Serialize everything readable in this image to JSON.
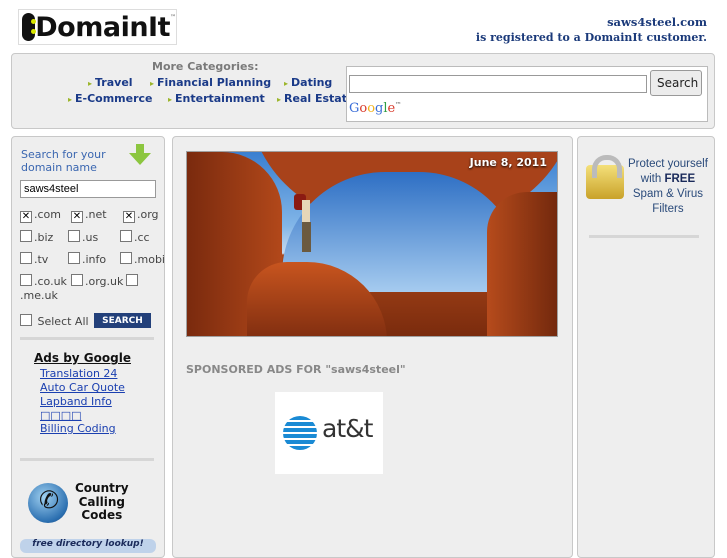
{
  "header": {
    "logo_text": "DomainIt",
    "logo_tm": "™",
    "registered_domain": "saws4steel.com",
    "registered_text": "is registered to a DomainIt customer."
  },
  "categories": {
    "title": "More Categories:",
    "items": [
      "Travel",
      "Financial Planning",
      "Dating",
      "E-Commerce",
      "Entertainment",
      "Real Estate"
    ]
  },
  "web_search": {
    "value": "",
    "button_label": "Search",
    "provider": "Google"
  },
  "domain_search": {
    "label_line1": "Search for your",
    "label_line2": "domain name",
    "value": "saws4steel",
    "tlds": [
      {
        "label": ".com",
        "checked": true
      },
      {
        "label": ".net",
        "checked": true
      },
      {
        "label": ".org",
        "checked": true
      },
      {
        "label": ".biz",
        "checked": false
      },
      {
        "label": ".us",
        "checked": false
      },
      {
        "label": ".cc",
        "checked": false
      },
      {
        "label": ".tv",
        "checked": false
      },
      {
        "label": ".info",
        "checked": false
      },
      {
        "label": ".mobi",
        "checked": false
      },
      {
        "label": ".co.uk",
        "checked": false
      },
      {
        "label": ".org.uk",
        "checked": false
      },
      {
        "label": ".me.uk",
        "checked": false
      }
    ],
    "select_all_label": "Select All",
    "search_button_label": "SEARCH"
  },
  "google_ads": {
    "title": "Ads by Google",
    "links": [
      "Translation 24",
      "Auto Car Quote",
      "Lapband Info",
      "□□□□",
      "Billing Coding"
    ]
  },
  "country_calling": {
    "line1": "Country",
    "line2": "Calling",
    "line3": "Codes",
    "banner": "free directory lookup!"
  },
  "hero": {
    "date": "June 8, 2011"
  },
  "sponsored": {
    "title": "SPONSORED ADS FOR \"saws4steel\"",
    "ad_brand": "at&t"
  },
  "right_ad": {
    "line1": "Protect yourself",
    "line2_prefix": "with ",
    "line2_bold": "FREE",
    "line3": "Spam & Virus",
    "line4": "Filters"
  }
}
